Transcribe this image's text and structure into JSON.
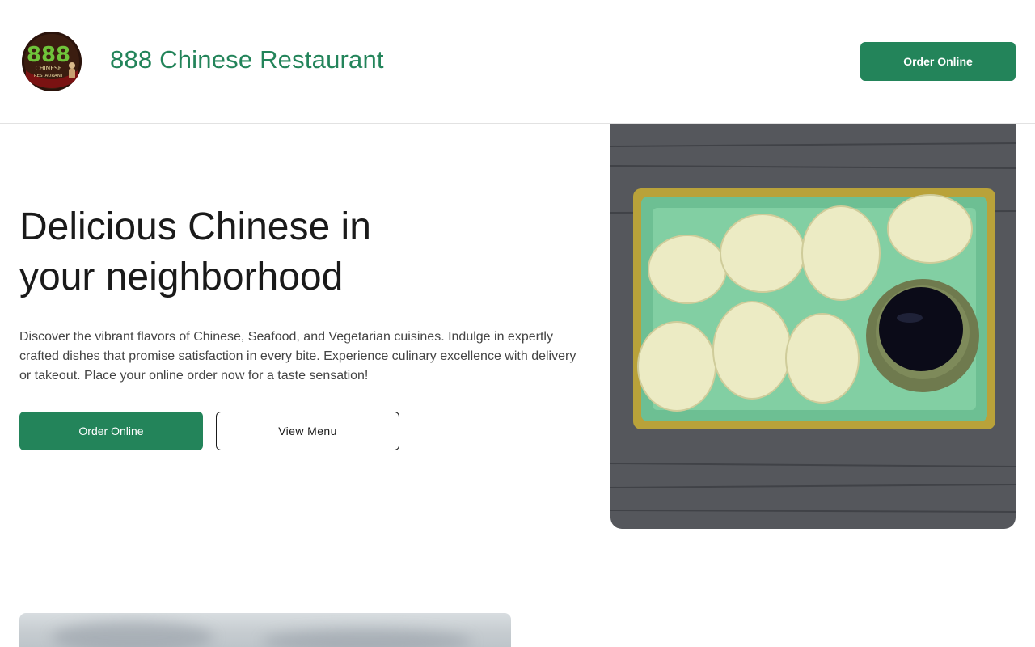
{
  "header": {
    "logo": {
      "name": "888 chinese restaurant logo",
      "text_main": "888",
      "text_line1": "CHINESE",
      "text_line2": "RESTAURANT"
    },
    "site_title": "888 Chinese Restaurant",
    "order_button_label": "Order Online"
  },
  "hero": {
    "title": "Delicious Chinese in your neighborhood",
    "description": "Discover the vibrant flavors of Chinese, Seafood, and Vegetarian cuisines. Indulge in expertly crafted dishes that promise satisfaction in every bite. Experience culinary excellence with delivery or takeout. Place your online order now for a taste sensation!",
    "order_button_label": "Order Online",
    "menu_button_label": "View Menu",
    "image_name": "dumplings-photo"
  },
  "section2": {
    "image_name": "secondary-photo"
  },
  "colors": {
    "brand": "#23845a",
    "text": "#1a1a1a",
    "muted_text": "#444444",
    "border": "#e2e2e2"
  }
}
